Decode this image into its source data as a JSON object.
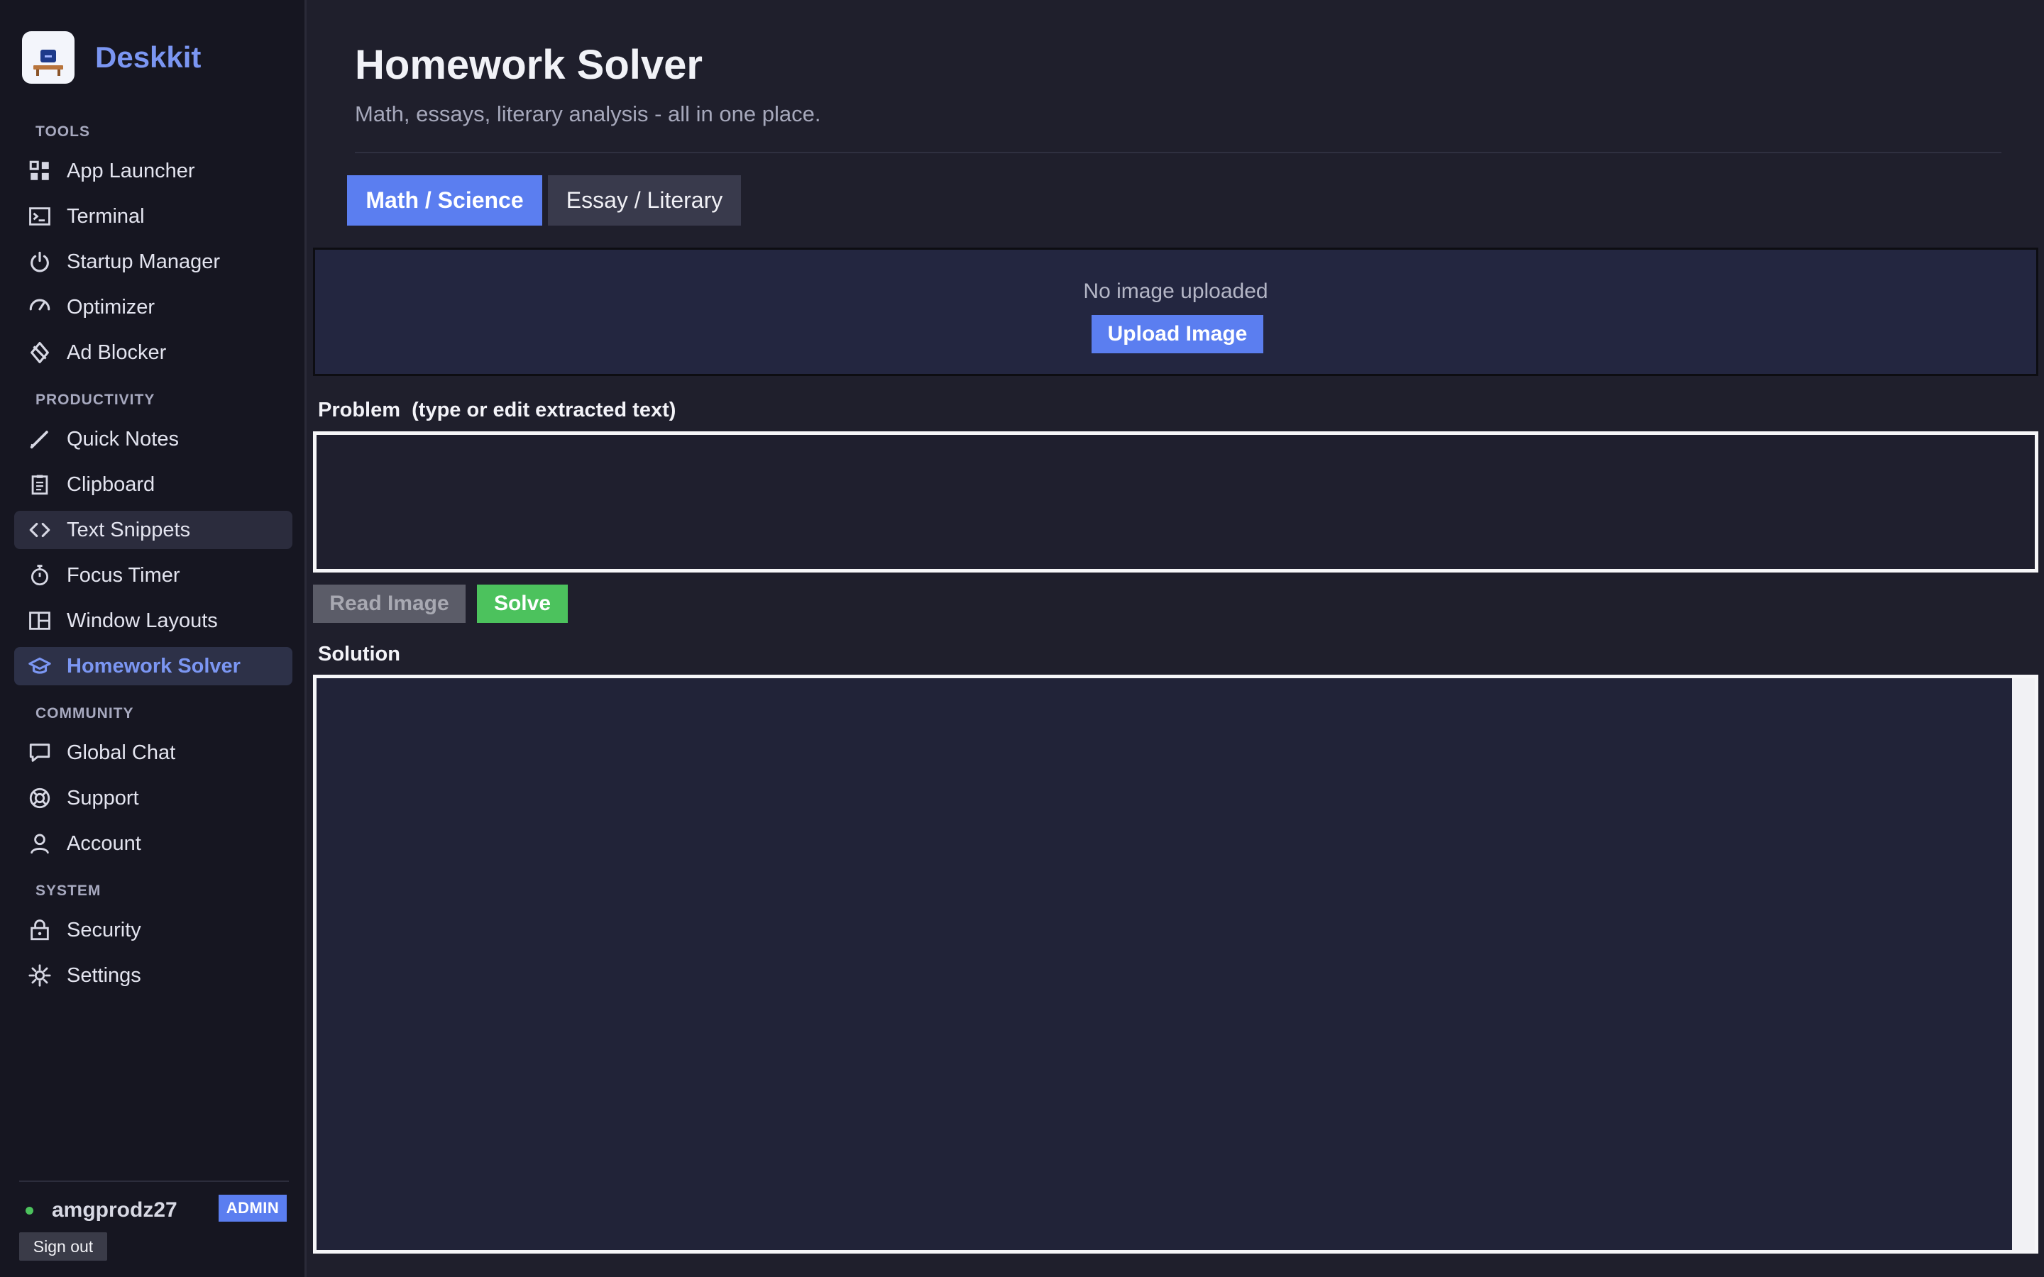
{
  "app": {
    "name": "Deskkit"
  },
  "sidebar": {
    "sections": [
      {
        "label": "TOOLS"
      },
      {
        "label": "PRODUCTIVITY"
      },
      {
        "label": "COMMUNITY"
      },
      {
        "label": "SYSTEM"
      }
    ],
    "items": [
      {
        "label": "App Launcher",
        "icon": "grid-icon"
      },
      {
        "label": "Terminal",
        "icon": "terminal-icon"
      },
      {
        "label": "Startup Manager",
        "icon": "power-icon"
      },
      {
        "label": "Optimizer",
        "icon": "gauge-icon"
      },
      {
        "label": "Ad Blocker",
        "icon": "shield-block-icon"
      },
      {
        "label": "Quick Notes",
        "icon": "pencil-icon"
      },
      {
        "label": "Clipboard",
        "icon": "clipboard-icon"
      },
      {
        "label": "Text Snippets",
        "icon": "code-icon"
      },
      {
        "label": "Focus Timer",
        "icon": "stopwatch-icon"
      },
      {
        "label": "Window Layouts",
        "icon": "layout-icon"
      },
      {
        "label": "Homework Solver",
        "icon": "graduation-cap-icon",
        "active": true
      },
      {
        "label": "Global Chat",
        "icon": "chat-icon"
      },
      {
        "label": "Support",
        "icon": "lifebuoy-icon"
      },
      {
        "label": "Account",
        "icon": "user-icon"
      },
      {
        "label": "Security",
        "icon": "lock-icon"
      },
      {
        "label": "Settings",
        "icon": "gear-icon"
      }
    ],
    "user": {
      "name": "amgprodz27",
      "role": "ADMIN",
      "online": true
    },
    "signout_label": "Sign out"
  },
  "main": {
    "title": "Homework Solver",
    "subtitle": "Math, essays, literary analysis - all in one place.",
    "tabs": [
      {
        "label": "Math / Science",
        "active": true
      },
      {
        "label": "Essay / Literary",
        "active": false
      }
    ],
    "upload": {
      "status": "No image uploaded",
      "button_label": "Upload Image"
    },
    "problem": {
      "label": "Problem  (type or edit extracted text)",
      "value": ""
    },
    "actions": {
      "read_label": "Read Image",
      "solve_label": "Solve"
    },
    "solution": {
      "label": "Solution"
    }
  },
  "colors": {
    "accent": "#5b7ef0",
    "brand_text": "#7b96f2",
    "success": "#4cc25d",
    "background": "#1f1f2c",
    "sidebar": "#161621"
  }
}
